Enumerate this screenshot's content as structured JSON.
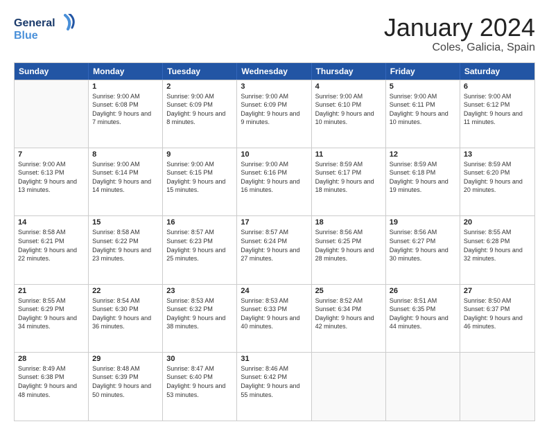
{
  "logo": {
    "line1": "General",
    "line2": "Blue"
  },
  "title": "January 2024",
  "subtitle": "Coles, Galicia, Spain",
  "days": [
    "Sunday",
    "Monday",
    "Tuesday",
    "Wednesday",
    "Thursday",
    "Friday",
    "Saturday"
  ],
  "weeks": [
    [
      {
        "day": "",
        "sunrise": "",
        "sunset": "",
        "daylight": ""
      },
      {
        "day": "1",
        "sunrise": "Sunrise: 9:00 AM",
        "sunset": "Sunset: 6:08 PM",
        "daylight": "Daylight: 9 hours and 7 minutes."
      },
      {
        "day": "2",
        "sunrise": "Sunrise: 9:00 AM",
        "sunset": "Sunset: 6:09 PM",
        "daylight": "Daylight: 9 hours and 8 minutes."
      },
      {
        "day": "3",
        "sunrise": "Sunrise: 9:00 AM",
        "sunset": "Sunset: 6:09 PM",
        "daylight": "Daylight: 9 hours and 9 minutes."
      },
      {
        "day": "4",
        "sunrise": "Sunrise: 9:00 AM",
        "sunset": "Sunset: 6:10 PM",
        "daylight": "Daylight: 9 hours and 10 minutes."
      },
      {
        "day": "5",
        "sunrise": "Sunrise: 9:00 AM",
        "sunset": "Sunset: 6:11 PM",
        "daylight": "Daylight: 9 hours and 10 minutes."
      },
      {
        "day": "6",
        "sunrise": "Sunrise: 9:00 AM",
        "sunset": "Sunset: 6:12 PM",
        "daylight": "Daylight: 9 hours and 11 minutes."
      }
    ],
    [
      {
        "day": "7",
        "sunrise": "Sunrise: 9:00 AM",
        "sunset": "Sunset: 6:13 PM",
        "daylight": "Daylight: 9 hours and 13 minutes."
      },
      {
        "day": "8",
        "sunrise": "Sunrise: 9:00 AM",
        "sunset": "Sunset: 6:14 PM",
        "daylight": "Daylight: 9 hours and 14 minutes."
      },
      {
        "day": "9",
        "sunrise": "Sunrise: 9:00 AM",
        "sunset": "Sunset: 6:15 PM",
        "daylight": "Daylight: 9 hours and 15 minutes."
      },
      {
        "day": "10",
        "sunrise": "Sunrise: 9:00 AM",
        "sunset": "Sunset: 6:16 PM",
        "daylight": "Daylight: 9 hours and 16 minutes."
      },
      {
        "day": "11",
        "sunrise": "Sunrise: 8:59 AM",
        "sunset": "Sunset: 6:17 PM",
        "daylight": "Daylight: 9 hours and 18 minutes."
      },
      {
        "day": "12",
        "sunrise": "Sunrise: 8:59 AM",
        "sunset": "Sunset: 6:18 PM",
        "daylight": "Daylight: 9 hours and 19 minutes."
      },
      {
        "day": "13",
        "sunrise": "Sunrise: 8:59 AM",
        "sunset": "Sunset: 6:20 PM",
        "daylight": "Daylight: 9 hours and 20 minutes."
      }
    ],
    [
      {
        "day": "14",
        "sunrise": "Sunrise: 8:58 AM",
        "sunset": "Sunset: 6:21 PM",
        "daylight": "Daylight: 9 hours and 22 minutes."
      },
      {
        "day": "15",
        "sunrise": "Sunrise: 8:58 AM",
        "sunset": "Sunset: 6:22 PM",
        "daylight": "Daylight: 9 hours and 23 minutes."
      },
      {
        "day": "16",
        "sunrise": "Sunrise: 8:57 AM",
        "sunset": "Sunset: 6:23 PM",
        "daylight": "Daylight: 9 hours and 25 minutes."
      },
      {
        "day": "17",
        "sunrise": "Sunrise: 8:57 AM",
        "sunset": "Sunset: 6:24 PM",
        "daylight": "Daylight: 9 hours and 27 minutes."
      },
      {
        "day": "18",
        "sunrise": "Sunrise: 8:56 AM",
        "sunset": "Sunset: 6:25 PM",
        "daylight": "Daylight: 9 hours and 28 minutes."
      },
      {
        "day": "19",
        "sunrise": "Sunrise: 8:56 AM",
        "sunset": "Sunset: 6:27 PM",
        "daylight": "Daylight: 9 hours and 30 minutes."
      },
      {
        "day": "20",
        "sunrise": "Sunrise: 8:55 AM",
        "sunset": "Sunset: 6:28 PM",
        "daylight": "Daylight: 9 hours and 32 minutes."
      }
    ],
    [
      {
        "day": "21",
        "sunrise": "Sunrise: 8:55 AM",
        "sunset": "Sunset: 6:29 PM",
        "daylight": "Daylight: 9 hours and 34 minutes."
      },
      {
        "day": "22",
        "sunrise": "Sunrise: 8:54 AM",
        "sunset": "Sunset: 6:30 PM",
        "daylight": "Daylight: 9 hours and 36 minutes."
      },
      {
        "day": "23",
        "sunrise": "Sunrise: 8:53 AM",
        "sunset": "Sunset: 6:32 PM",
        "daylight": "Daylight: 9 hours and 38 minutes."
      },
      {
        "day": "24",
        "sunrise": "Sunrise: 8:53 AM",
        "sunset": "Sunset: 6:33 PM",
        "daylight": "Daylight: 9 hours and 40 minutes."
      },
      {
        "day": "25",
        "sunrise": "Sunrise: 8:52 AM",
        "sunset": "Sunset: 6:34 PM",
        "daylight": "Daylight: 9 hours and 42 minutes."
      },
      {
        "day": "26",
        "sunrise": "Sunrise: 8:51 AM",
        "sunset": "Sunset: 6:35 PM",
        "daylight": "Daylight: 9 hours and 44 minutes."
      },
      {
        "day": "27",
        "sunrise": "Sunrise: 8:50 AM",
        "sunset": "Sunset: 6:37 PM",
        "daylight": "Daylight: 9 hours and 46 minutes."
      }
    ],
    [
      {
        "day": "28",
        "sunrise": "Sunrise: 8:49 AM",
        "sunset": "Sunset: 6:38 PM",
        "daylight": "Daylight: 9 hours and 48 minutes."
      },
      {
        "day": "29",
        "sunrise": "Sunrise: 8:48 AM",
        "sunset": "Sunset: 6:39 PM",
        "daylight": "Daylight: 9 hours and 50 minutes."
      },
      {
        "day": "30",
        "sunrise": "Sunrise: 8:47 AM",
        "sunset": "Sunset: 6:40 PM",
        "daylight": "Daylight: 9 hours and 53 minutes."
      },
      {
        "day": "31",
        "sunrise": "Sunrise: 8:46 AM",
        "sunset": "Sunset: 6:42 PM",
        "daylight": "Daylight: 9 hours and 55 minutes."
      },
      {
        "day": "",
        "sunrise": "",
        "sunset": "",
        "daylight": ""
      },
      {
        "day": "",
        "sunrise": "",
        "sunset": "",
        "daylight": ""
      },
      {
        "day": "",
        "sunrise": "",
        "sunset": "",
        "daylight": ""
      }
    ]
  ]
}
